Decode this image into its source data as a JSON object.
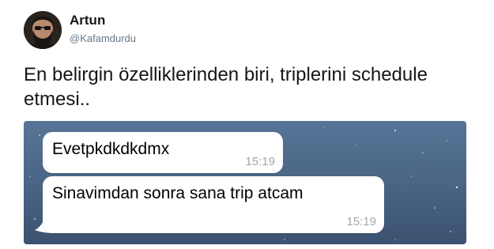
{
  "author": {
    "display_name": "Artun",
    "handle": "@Kafamdurdu"
  },
  "tweet": {
    "text": "En belirgin özelliklerinden biri, triplerini schedule etmesi.."
  },
  "media": {
    "background_color": "#4a6585",
    "messages": [
      {
        "text": "Evetpkdkdkdmx",
        "time": "15:19"
      },
      {
        "text": "Sinavimdan sonra sana trip atcam",
        "time": "15:19"
      }
    ]
  },
  "colors": {
    "name": "#14171a",
    "handle": "#657786",
    "bubble": "#ffffff",
    "timestamp": "#a0a6ab"
  },
  "icons": {
    "avatar": "bearded-man-with-sunglasses-avatar"
  }
}
